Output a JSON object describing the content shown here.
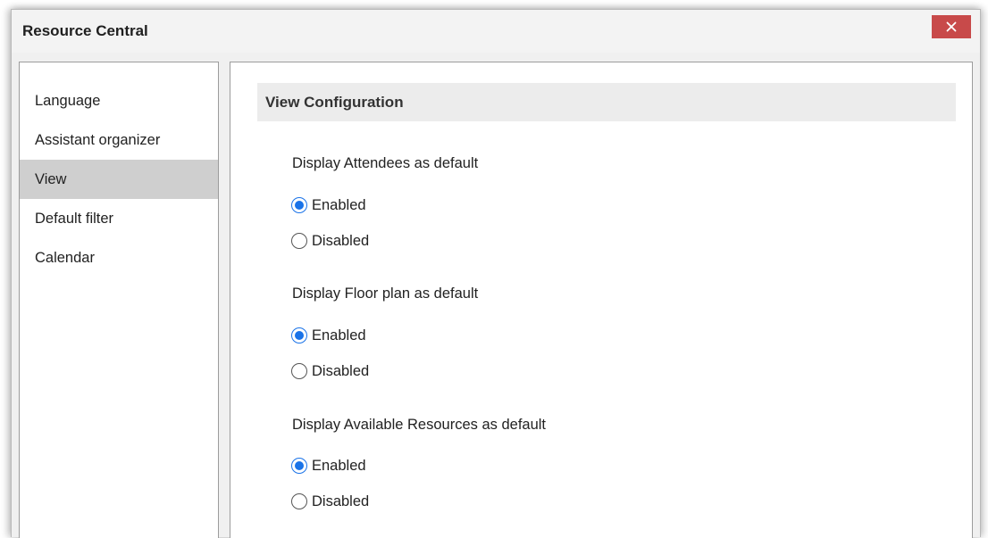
{
  "window": {
    "title": "Resource Central"
  },
  "sidebar": {
    "items": [
      {
        "label": "Language"
      },
      {
        "label": "Assistant organizer"
      },
      {
        "label": "View",
        "selected": true
      },
      {
        "label": "Default filter"
      },
      {
        "label": "Calendar"
      }
    ]
  },
  "main": {
    "section_title": "View Configuration",
    "groups": [
      {
        "label": "Display Attendees as default",
        "options": [
          {
            "label": "Enabled",
            "checked": true
          },
          {
            "label": "Disabled",
            "checked": false
          }
        ]
      },
      {
        "label": "Display Floor plan as default",
        "options": [
          {
            "label": "Enabled",
            "checked": true
          },
          {
            "label": "Disabled",
            "checked": false
          }
        ]
      },
      {
        "label": "Display Available Resources as default",
        "options": [
          {
            "label": "Enabled",
            "checked": true
          },
          {
            "label": "Disabled",
            "checked": false
          }
        ]
      }
    ]
  },
  "icons": {
    "close": "close-icon",
    "radio": "radio-button-icon"
  },
  "colors": {
    "close_button": "#c84a4a",
    "selected_item": "#cfcfcf",
    "radio_accent": "#1a73e8",
    "section_header": "#ececec"
  }
}
